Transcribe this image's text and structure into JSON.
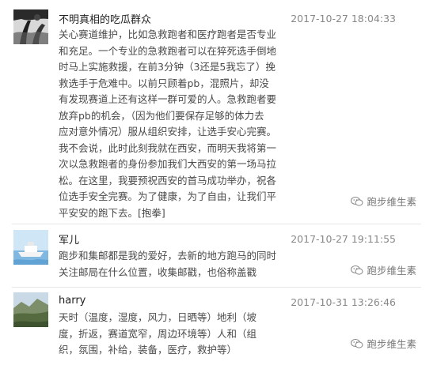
{
  "comments": [
    {
      "name": "不明真相的吃瓜群众",
      "time": "2017-10-27 18:04:33",
      "lines": [
        "关心赛道维护，比如急救跑者和医疗跑者是否专业",
        "和充足。一个专业的急救跑者可以在猝死选手倒地",
        "时马上实施救援，在前3分钟（3还是5我忘了）挽",
        "救选手于危难中。以前只顾着pb，混照片，却没",
        "有发现赛道上还有这样一群可爱的人。急救跑者要",
        "放弃pb的机会，（因为他们要保存足够的体力去",
        "应对意外情况）服从组织安排，让选手安心完赛。",
        "我不会说，此时此刻我就在西安，而明天我将第一",
        "次以急救跑者的身份参加我们大西安的第一场马拉",
        "松。在这里，我要预祝西安的首马成功举办，祝各",
        "位选手安全完赛。为了健康，为了自由，让我们平",
        "平安安的跑下去。[抱拳]"
      ],
      "watermark": "跑步维生素"
    },
    {
      "name": "军儿",
      "time": "2017-10-27 19:11:55",
      "lines": [
        "跑步和集邮都是我的爱好，去新的地方跑马的同时",
        "关注邮局在什么位置，收集邮戳，也俗称盖戳"
      ],
      "watermark": "跑步维生素"
    },
    {
      "name": "harry",
      "time": "2017-10-31 13:26:46",
      "lines": [
        "天时（温度，湿度，风力，日晒等）地利（坡",
        "度，折返，赛道宽窄，周边环境等）人和（组",
        "织，氛围，补给，装备，医疗，救护等）"
      ],
      "watermark": "跑步维生素"
    }
  ],
  "icons": {
    "watermark_icon": "wechat-icon"
  }
}
